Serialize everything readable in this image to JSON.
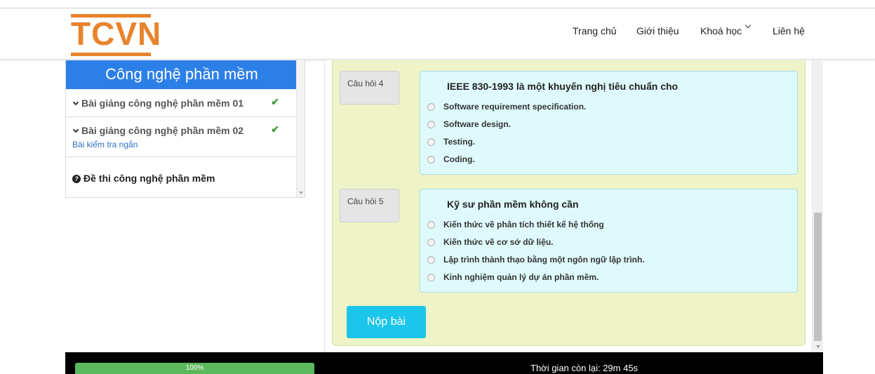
{
  "brand": {
    "logo_text": "TCVN",
    "accent_color": "#e8832b"
  },
  "nav": {
    "home": "Trang chủ",
    "about": "Giới thiệu",
    "courses": "Khoá học",
    "contact": "Liên hệ"
  },
  "sidebar": {
    "title": "Công nghệ phần mềm",
    "items": [
      {
        "label": "Bài giảng công nghệ phần mềm 01",
        "completed": true
      },
      {
        "label": "Bài giảng công nghệ phần mềm 02",
        "completed": true,
        "sub_link": "Bài kiểm tra ngắn"
      },
      {
        "label": "Đề thi công nghệ phần mềm"
      }
    ]
  },
  "questions": [
    {
      "label": "Câu hỏi 4",
      "title": "IEEE 830-1993 là một khuyến nghị tiêu chuẩn cho",
      "options": [
        "Software requirement specification.",
        "Software design.",
        "Testing.",
        "Coding."
      ]
    },
    {
      "label": "Câu hỏi 5",
      "title": "Kỹ sư phần mềm không cần",
      "options": [
        "Kiến thức về phân tích thiết kế hệ thống",
        "Kiến thức về cơ sở dữ liệu.",
        "Lập trình thành thạo bằng một ngôn ngữ lập trình.",
        "Kinh nghiệm quản lý dự án phần mềm."
      ]
    }
  ],
  "submit_label": "Nộp bài",
  "footer": {
    "progress_text": "100%",
    "progress_value": 1.0,
    "timer_text": "Thời gian còn lại: 29m 45s"
  },
  "icons": {
    "check": "check-icon",
    "caret": "caret-down-icon",
    "question": "question-circle-icon"
  }
}
